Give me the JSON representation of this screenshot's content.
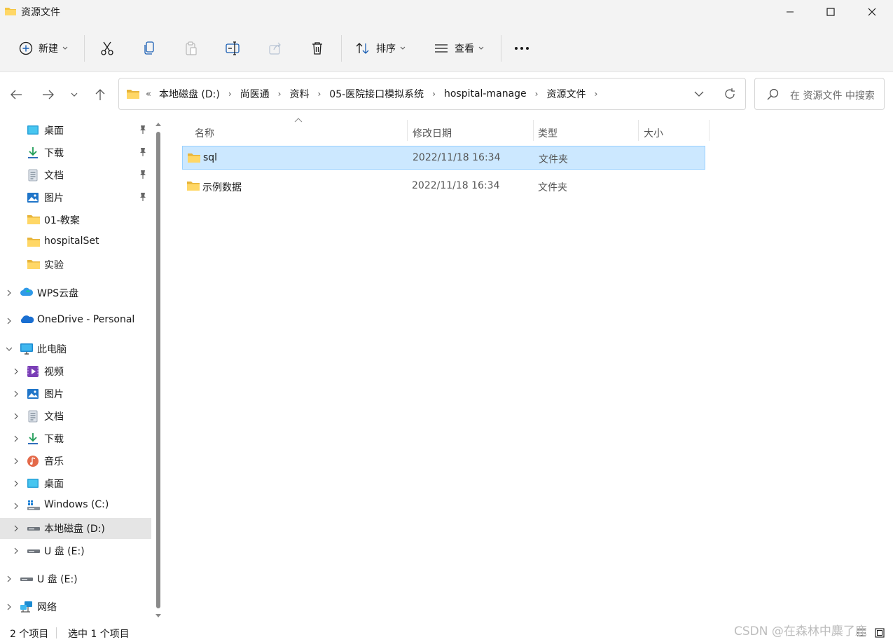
{
  "window": {
    "title": "资源文件"
  },
  "toolbar": {
    "new_label": "新建",
    "sort_label": "排序",
    "view_label": "查看"
  },
  "address": {
    "lead": "«",
    "crumbs": [
      "本地磁盘 (D:)",
      "尚医通",
      "资料",
      "05-医院接口模拟系统",
      "hospital-manage",
      "资源文件"
    ]
  },
  "search": {
    "placeholder": "在 资源文件 中搜索"
  },
  "sidebar": {
    "quick": [
      {
        "label": "桌面",
        "icon": "desktop-icon",
        "pinned": true
      },
      {
        "label": "下载",
        "icon": "download-icon",
        "pinned": true
      },
      {
        "label": "文档",
        "icon": "document-icon",
        "pinned": true
      },
      {
        "label": "图片",
        "icon": "picture-icon",
        "pinned": true
      },
      {
        "label": "01-教案",
        "icon": "folder-icon",
        "pinned": false
      },
      {
        "label": "hospitalSet",
        "icon": "folder-icon",
        "pinned": false
      },
      {
        "label": "实验",
        "icon": "folder-icon",
        "pinned": false
      }
    ],
    "wps": "WPS云盘",
    "onedrive": "OneDrive - Personal",
    "thispc": "此电脑",
    "pc_items": [
      {
        "label": "视频",
        "icon": "video-icon"
      },
      {
        "label": "图片",
        "icon": "picture-icon"
      },
      {
        "label": "文档",
        "icon": "document-icon"
      },
      {
        "label": "下载",
        "icon": "download-icon"
      },
      {
        "label": "音乐",
        "icon": "music-icon"
      },
      {
        "label": "桌面",
        "icon": "desktop-icon"
      },
      {
        "label": "Windows (C:)",
        "icon": "windows-drive-icon"
      },
      {
        "label": "本地磁盘 (D:)",
        "icon": "drive-icon",
        "selected": true
      },
      {
        "label": "U 盘 (E:)",
        "icon": "usb-drive-icon"
      }
    ],
    "usb": "U 盘 (E:)",
    "network": "网络"
  },
  "columns": {
    "name": "名称",
    "date": "修改日期",
    "type": "类型",
    "size": "大小"
  },
  "files": [
    {
      "name": "sql",
      "date": "2022/11/18 16:34",
      "type": "文件夹",
      "selected": true
    },
    {
      "name": "示例数据",
      "date": "2022/11/18 16:34",
      "type": "文件夹",
      "selected": false
    }
  ],
  "status": {
    "count": "2 个项目",
    "selection": "选中 1 个项目"
  },
  "watermark": "CSDN @在森林中麋了鹿",
  "colors": {
    "selection_bg": "#cce8ff",
    "selection_border": "#99d1ff",
    "folder": "#f4c542"
  }
}
